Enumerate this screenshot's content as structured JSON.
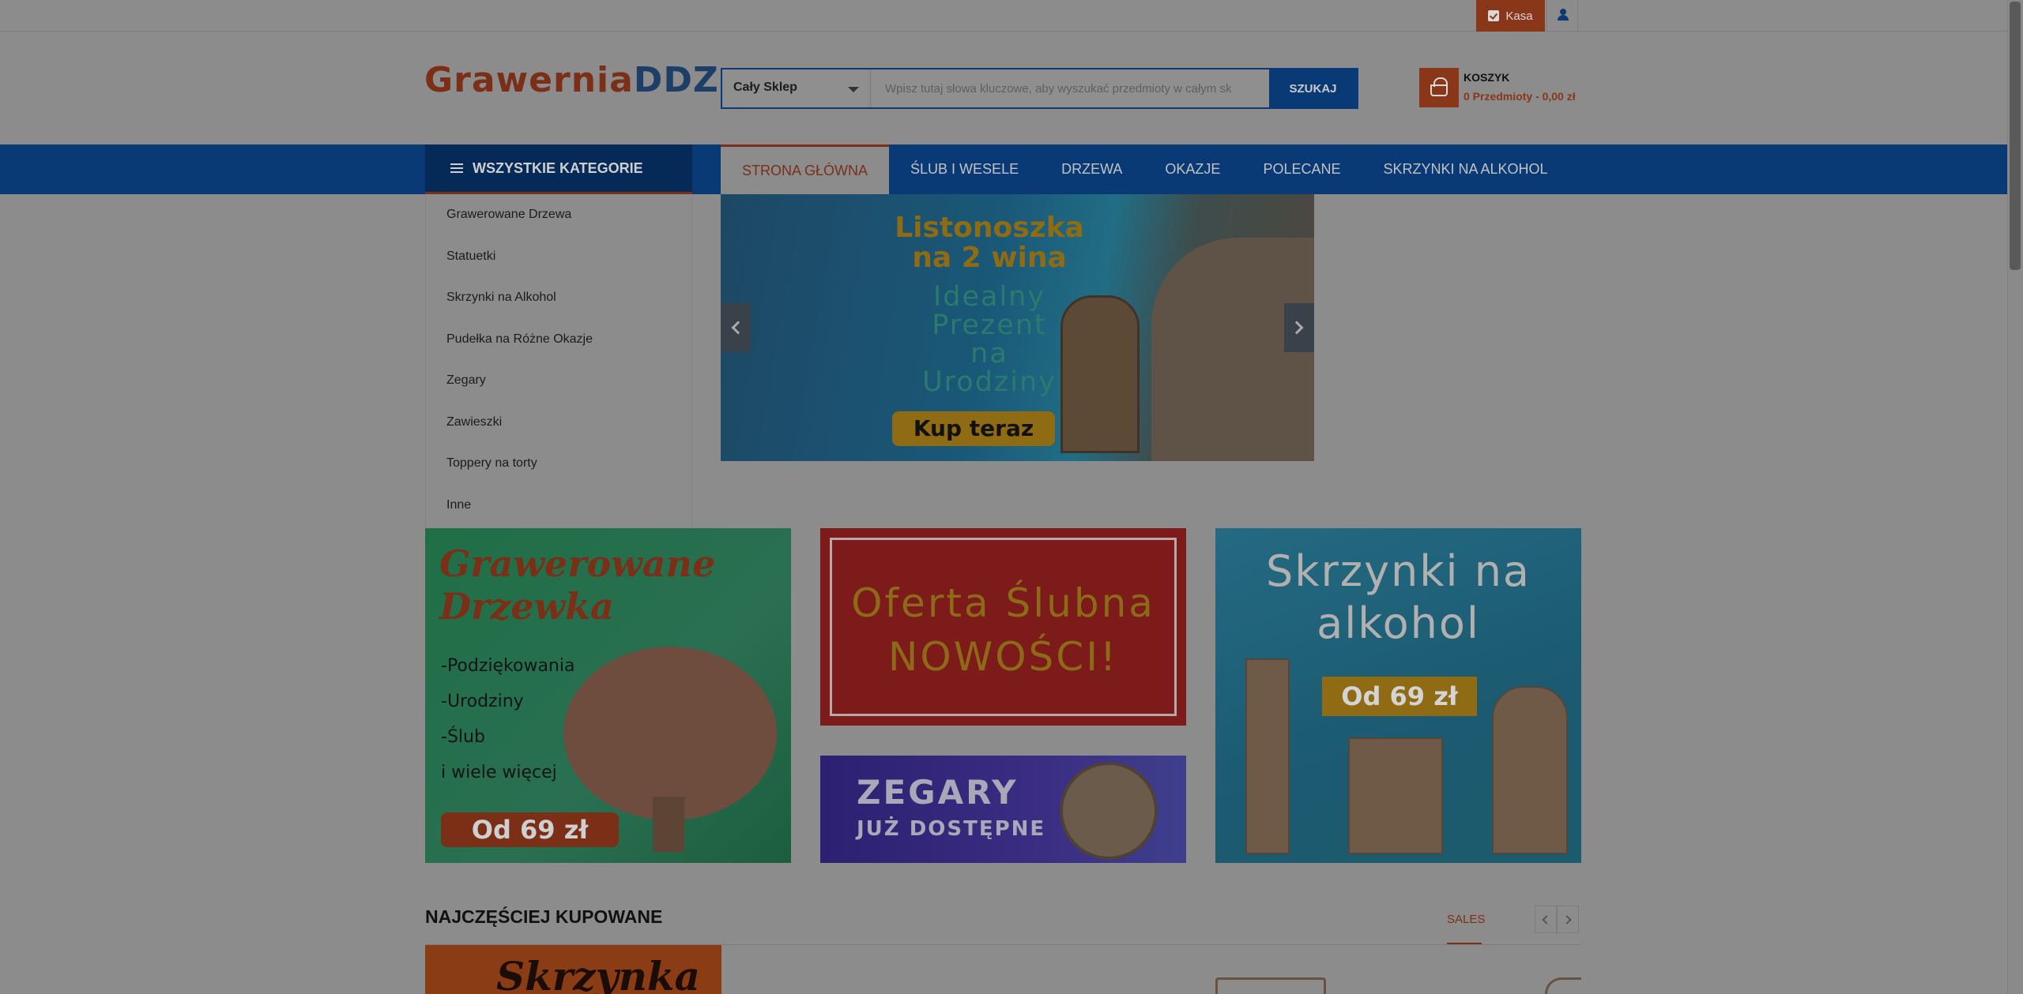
{
  "topbar": {
    "kasa_label": "Kasa"
  },
  "logo": {
    "part1": "Grawernia",
    "part2": "DDZ"
  },
  "search": {
    "category": "Cały Sklep",
    "placeholder": "Wpisz tutaj słowa kluczowe, aby wyszukać przedmioty w całym sk",
    "button": "SZUKAJ"
  },
  "cart": {
    "title": "KOSZYK",
    "summary": "0 Przedmioty - 0,00 zł"
  },
  "nav": {
    "all_categories": "WSZYSTKIE KATEGORIE",
    "items": [
      "STRONA GŁÓWNA",
      "ŚLUB I WESELE",
      "DRZEWA",
      "OKAZJE",
      "POLECANE",
      "SKRZYNKI NA ALKOHOL"
    ]
  },
  "sidebar": {
    "items": [
      "Grawerowane Drzewa",
      "Statuetki",
      "Skrzynki na Alkohol",
      "Pudełka na Różne Okazje",
      "Zegary",
      "Zawieszki",
      "Toppery na torty",
      "Inne"
    ]
  },
  "slider": {
    "title1": "Listonoszka",
    "title2": "na 2 wina",
    "line1": "Idealny",
    "line2": "Prezent",
    "line3": "na",
    "line4": "Urodziny",
    "cta": "Kup teraz"
  },
  "banners": {
    "trees": {
      "title1": "Grawerowane",
      "title2": "Drzewka",
      "lines": [
        "-Podziękowania",
        "-Urodziny",
        "-Ślub",
        "i wiele więcej"
      ],
      "price": "Od 69 zł"
    },
    "wedding": {
      "line1": "Oferta Ślubna",
      "line2": "NOWOŚCI!"
    },
    "clocks": {
      "line1": "ZEGARY",
      "line2": "JUŻ DOSTĘPNE"
    },
    "boxes": {
      "line1": "Skrzynki na",
      "line2": "alkohol",
      "price": "Od 69 zł"
    }
  },
  "products": {
    "title": "NAJCZĘŚCIEJ KUPOWANE",
    "tab": "SALES",
    "item1_text": "Skrzynka"
  },
  "colors": {
    "primary": "#0a3a75",
    "accent": "#7a2f16",
    "overlay_bg": "#8c8c8c"
  }
}
